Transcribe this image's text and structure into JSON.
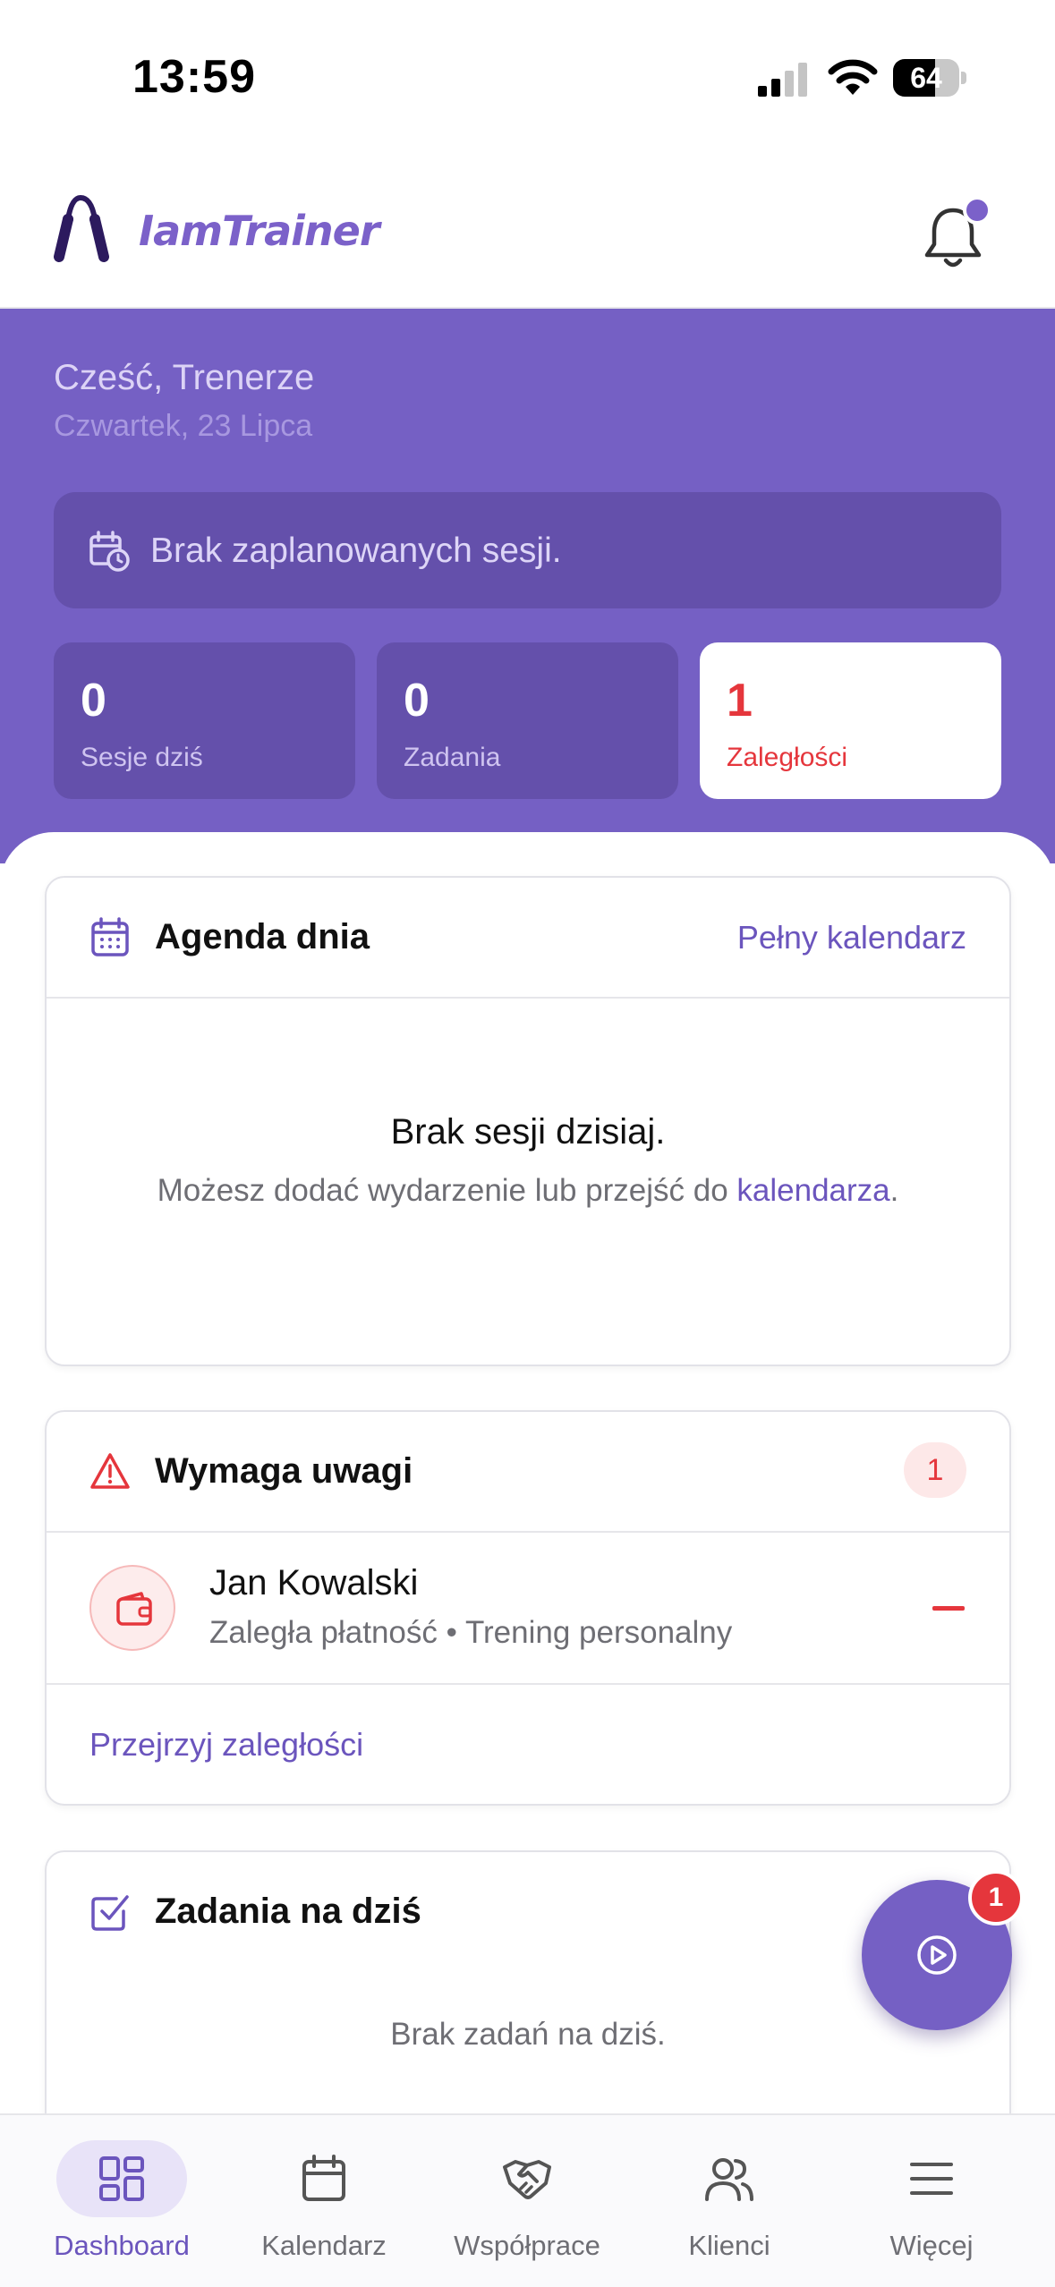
{
  "status_bar": {
    "time": "13:59",
    "battery": "64",
    "battery_level": 0.64
  },
  "header": {
    "app_name": "IamTrainer",
    "logo_icon": "hand-gripper-icon",
    "notification_icon": "bell-icon"
  },
  "hero": {
    "greeting": "Cześć, Trenerze",
    "date": "Czwartek, 23 Lipca",
    "no_sessions": "Brak zaplanowanych sesji.",
    "stats": [
      {
        "value": "0",
        "label": "Sesje dziś"
      },
      {
        "value": "0",
        "label": "Zadania"
      },
      {
        "value": "1",
        "label": "Zaległości"
      }
    ]
  },
  "agenda": {
    "title": "Agenda dnia",
    "link": "Pełny kalendarz",
    "empty_title": "Brak sesji dzisiaj.",
    "empty_desc_prefix": "Możesz dodać wydarzenie lub przejść do ",
    "empty_desc_link": "kalendarza",
    "empty_desc_suffix": "."
  },
  "attention": {
    "title": "Wymaga uwagi",
    "badge": "1",
    "items": [
      {
        "name": "Jan Kowalski",
        "detail": "Zaległa płatność • Trening personalny",
        "icon": "wallet-icon"
      }
    ],
    "footer_link": "Przejrzyj zaległości"
  },
  "tasks": {
    "title": "Zadania na dziś",
    "empty": "Brak zadań na dziś."
  },
  "fab": {
    "icon": "play-circle-icon",
    "badge": "1"
  },
  "nav": {
    "items": [
      {
        "label": "Dashboard",
        "icon": "dashboard-icon",
        "active": true
      },
      {
        "label": "Kalendarz",
        "icon": "calendar-icon",
        "active": false
      },
      {
        "label": "Współprace",
        "icon": "handshake-icon",
        "active": false
      },
      {
        "label": "Klienci",
        "icon": "users-icon",
        "active": false
      },
      {
        "label": "Więcej",
        "icon": "menu-icon",
        "active": false
      }
    ]
  },
  "colors": {
    "brand": "#7560c4",
    "accent_text": "#6b55bd",
    "danger": "#e5363c"
  }
}
